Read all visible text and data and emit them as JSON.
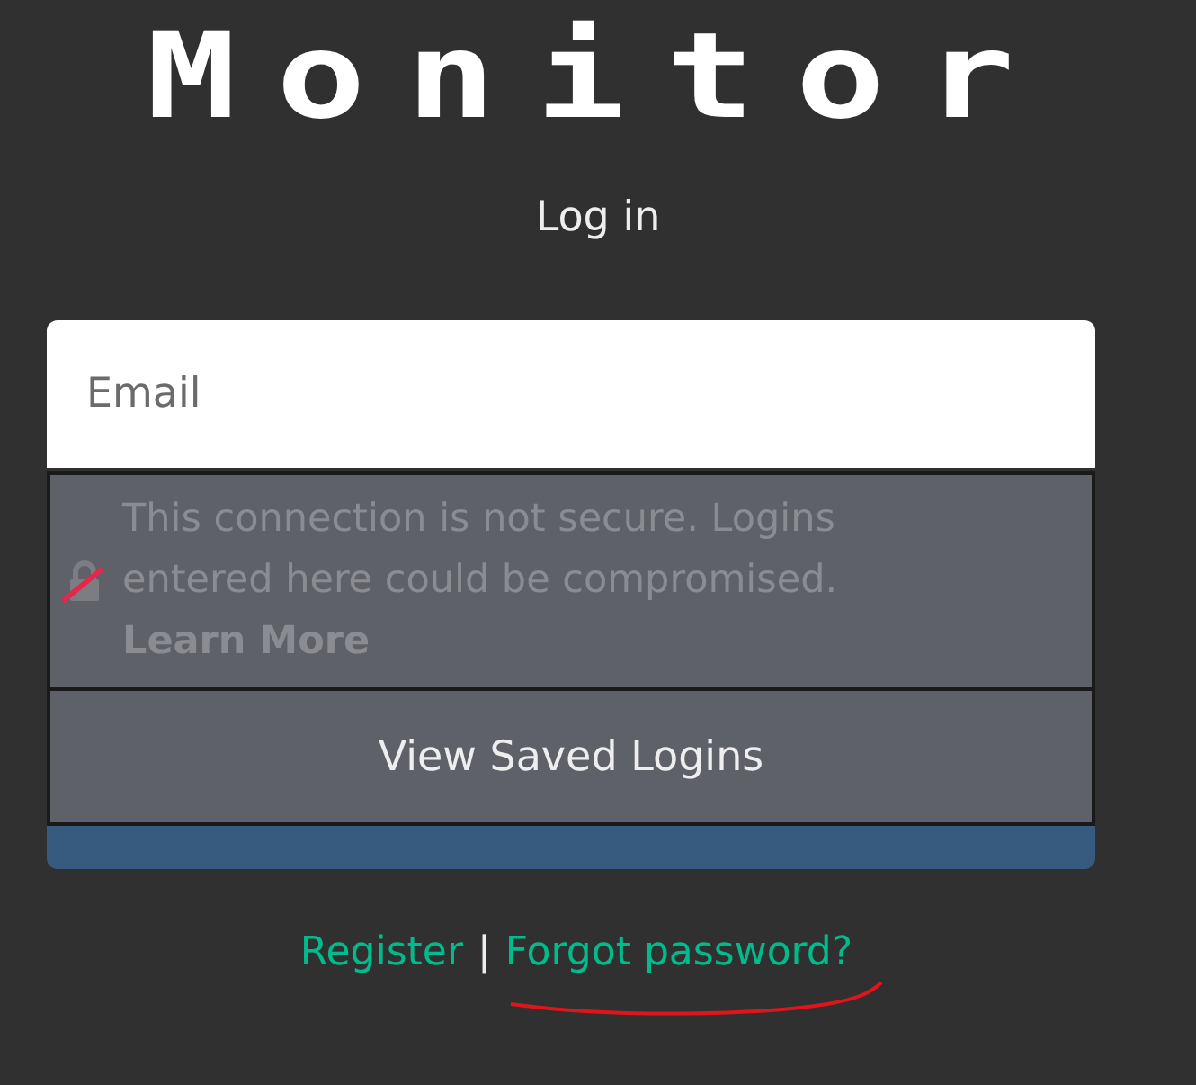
{
  "logo": "Monitor",
  "heading": "Log in",
  "email": {
    "placeholder": "Email"
  },
  "insecure_warning": {
    "text": "This connection is not secure. Logins entered here could be compromised.",
    "link": "Learn More"
  },
  "saved_logins_button": "View Saved Logins",
  "links": [
    {
      "label": "Register"
    },
    {
      "label": "Forgot password?"
    }
  ],
  "separator": "|"
}
